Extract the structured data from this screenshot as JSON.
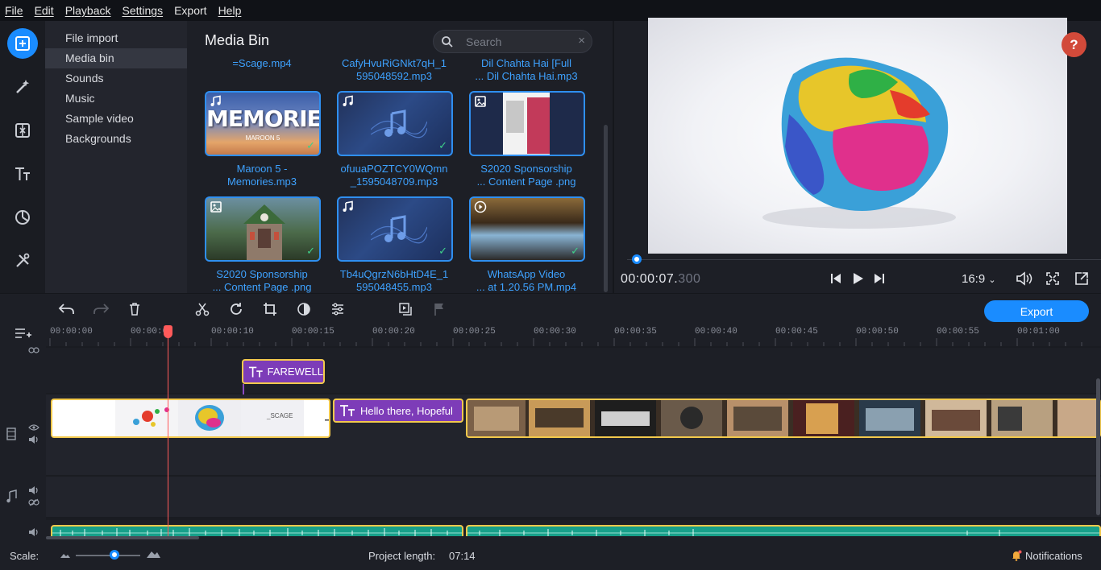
{
  "menu": {
    "file": "File",
    "edit": "Edit",
    "playback": "Playback",
    "settings": "Settings",
    "export": "Export",
    "help": "Help"
  },
  "nav": {
    "items": [
      "File import",
      "Media bin",
      "Sounds",
      "Music",
      "Sample video",
      "Backgrounds"
    ]
  },
  "media_bin": {
    "title": "Media Bin",
    "search_placeholder": "Search",
    "clear_icon": "×",
    "top_names": [
      "=Scage.mp4",
      "CafyHvuRiGNkt7qH_1\n595048592.mp3",
      "Dil Chahta Hai [Full\n... Dil Chahta Hai.mp3"
    ],
    "items": [
      {
        "name": "Maroon 5 -\nMemories.mp3",
        "type": "audio",
        "thumb_text": "MEMORIES",
        "thumb_sub": "MAROON 5"
      },
      {
        "name": "ofuuaPOZTCY0WQmn\n_1595048709.mp3",
        "type": "audio"
      },
      {
        "name": "S2020 Sponsorship\n... Content Page .png",
        "type": "image"
      },
      {
        "name": "S2020 Sponsorship\n... Content Page .png",
        "type": "image"
      },
      {
        "name": "Tb4uQgrzN6bHtD4E_1\n595048455.mp3",
        "type": "audio"
      },
      {
        "name": "WhatsApp Video\n... at 1.20.56 PM.mp4",
        "type": "video"
      }
    ]
  },
  "preview": {
    "help": "?",
    "timecode_main": "00:00:07.",
    "timecode_ms": "300",
    "aspect": "16:9",
    "progress": 0.02
  },
  "toolbar": {
    "export_label": "Export"
  },
  "timeline": {
    "ticks": [
      "00:00:00",
      "00:00:0",
      "00:00:10",
      "00:00:15",
      "00:00:20",
      "00:00:25",
      "00:00:30",
      "00:00:35",
      "00:00:40",
      "00:00:45",
      "00:00:50",
      "00:00:55",
      "00:01:00"
    ],
    "title_clip_1": "FAREWELL",
    "title_clip_2": "Hello there, Hopeful",
    "clip_scage_label": "_SCAGE"
  },
  "status": {
    "scale_label": "Scale:",
    "project_length_label": "Project length:",
    "project_length_value": "07:14",
    "notifications": "Notifications",
    "scale_level": 0.6
  },
  "colors": {
    "accent": "#1a8cff",
    "title_clip": "#7d3cb8",
    "clip_border": "#f2c94c",
    "audio_clip": "#17a08a",
    "playhead": "#ff5a5a",
    "link": "#3ea2ff"
  }
}
